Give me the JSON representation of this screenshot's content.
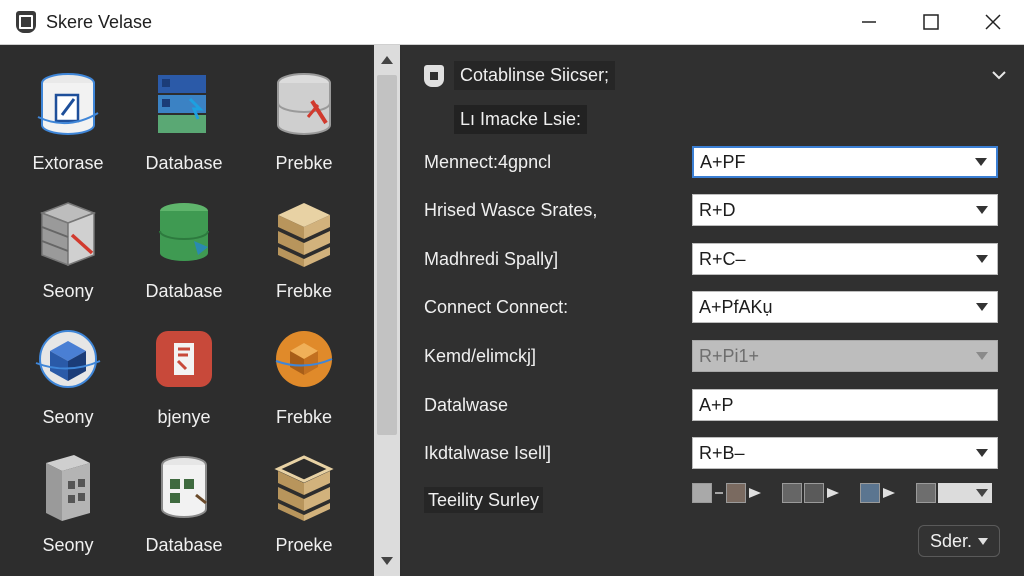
{
  "window": {
    "title": "Skere Velase"
  },
  "tiles": [
    {
      "label": "Extorase",
      "icon": "cylinder-doc-icon"
    },
    {
      "label": "Database",
      "icon": "stacked-database-icon"
    },
    {
      "label": "Prebke",
      "icon": "cylinder-tool-icon"
    },
    {
      "label": "Seony",
      "icon": "server-stack-icon"
    },
    {
      "label": "Database",
      "icon": "green-database-icon"
    },
    {
      "label": "Frebke",
      "icon": "layered-box-icon"
    },
    {
      "label": "Seony",
      "icon": "blue-cube-icon"
    },
    {
      "label": "bjenye",
      "icon": "red-document-icon"
    },
    {
      "label": "Frebke",
      "icon": "orange-sphere-icon"
    },
    {
      "label": "Seony",
      "icon": "building-icon"
    },
    {
      "label": "Database",
      "icon": "plant-database-icon"
    },
    {
      "label": "Proeke",
      "icon": "layered-box-icon"
    }
  ],
  "panel": {
    "section_title": "Cotablinse Siicser;",
    "subheader": "Lı Imacke Lsie:"
  },
  "fields": [
    {
      "label": "Mennect:4gpncl",
      "value": "A+PF",
      "state": "focused"
    },
    {
      "label": "Hrised Wasce Srates,",
      "value": "R+D",
      "state": "normal"
    },
    {
      "label": "Madhredi Spally]",
      "value": "R+C–",
      "state": "normal"
    },
    {
      "label": "Connect Connect:",
      "value": "A+PfAKụ",
      "state": "normal"
    },
    {
      "label": "Kemd/elimckj]",
      "value": "R+Pi1+",
      "state": "disabled"
    },
    {
      "label": "Datalwase",
      "value": "A+P",
      "state": "text"
    },
    {
      "label": "Ikdtalwase Isell]",
      "value": "R+B–",
      "state": "normal"
    }
  ],
  "tools": {
    "label": "Teeility Surley",
    "swatches": [
      "#a9a9a9",
      "#7a6a60",
      "#666666",
      "#5b7590",
      "#6e6e6e"
    ]
  },
  "button": {
    "label": "Sder."
  }
}
